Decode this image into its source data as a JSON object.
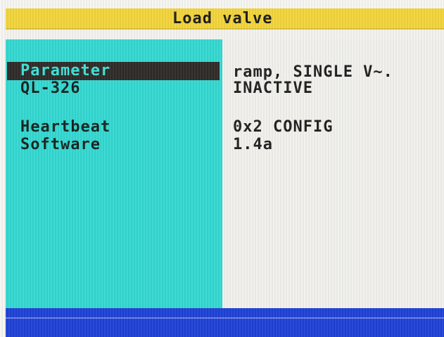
{
  "title": "Load valve",
  "rows": [
    {
      "label": "Parameter",
      "value": "ramp, SINGLE V~."
    },
    {
      "label": "QL-326",
      "value": "INACTIVE"
    },
    {
      "label": "Heartbeat",
      "value": "0x2 CONFIG"
    },
    {
      "label": "Software",
      "value": "1.4a"
    }
  ],
  "selected_row": "Parameter",
  "colors": {
    "title_bar": "#f2d43a",
    "left_panel": "#34d8d1",
    "right_panel": "#f1f0ec",
    "status_bar": "#1f40d6",
    "selection": "#2e2a28"
  }
}
